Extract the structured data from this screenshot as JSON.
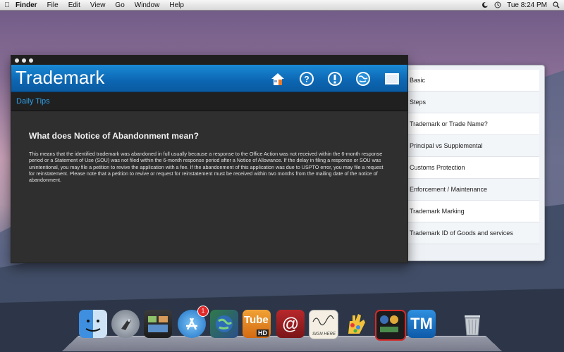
{
  "menubar": {
    "app_name": "Finder",
    "items": [
      "File",
      "Edit",
      "View",
      "Go",
      "Window",
      "Help"
    ],
    "clock": "Tue 8:24 PM"
  },
  "window": {
    "title": "Trademark",
    "subtitle": "Daily Tips",
    "question": "What does Notice of Abandonment mean?",
    "body": "This means that the identified trademark was abandoned in full usually because a response to the Office Action was not received within the 6-month response period or a Statement of Use (SOU) was not filed within the 6-month response period after a Notice of Allowance. If the delay in filing a response or SOU was unintentional, you may file a petition to revive the application with a fee. If the abandonment of this application was due to USPTO error, you may file a request for reinstatement. Please note that a petition to revive or request for reinstatement must be received within two months from the mailing date of the notice of abandonment."
  },
  "side_list": [
    "Basic",
    "Steps",
    "Trademark or Trade Name?",
    "Principal vs Supplemental",
    "Customs Protection",
    "Enforcement / Maintenance",
    "Trademark Marking",
    "Trademark ID of Goods and services"
  ],
  "dock": {
    "badge_count": "1",
    "tube_label": "Tube",
    "tube_sub": "HD",
    "sign_label": "SIGN HERE",
    "tm_label": "TM"
  },
  "colors": {
    "header_blue": "#0c66b2",
    "subtitle_blue": "#2e9fe8",
    "content_bg": "#2f2f2f"
  }
}
